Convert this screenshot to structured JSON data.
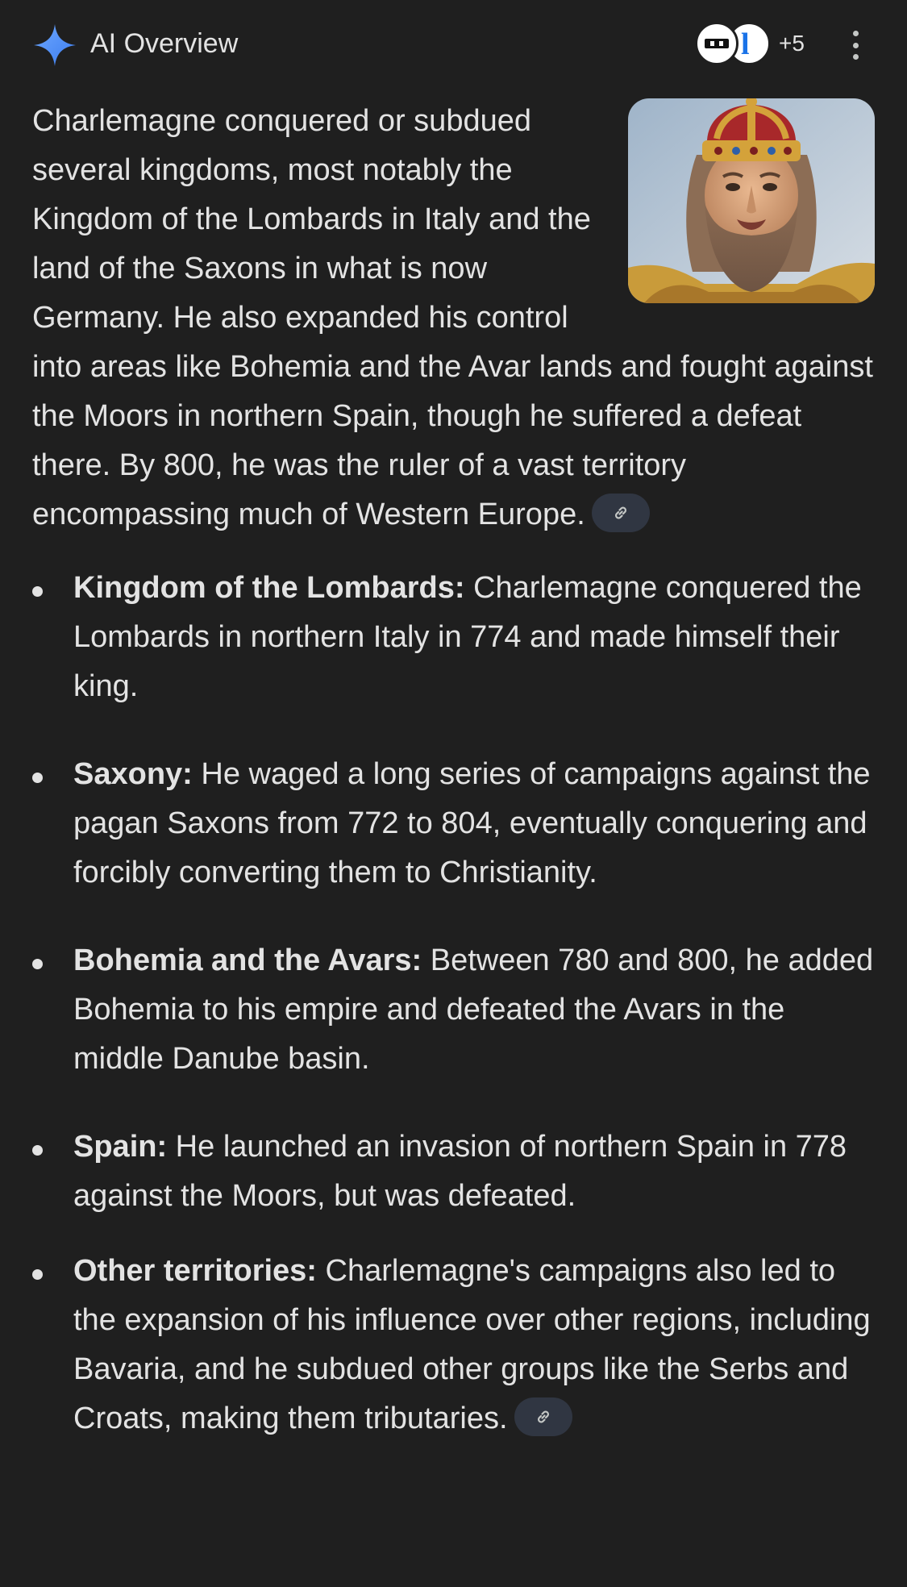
{
  "header": {
    "title": "AI Overview",
    "sparkle_icon": "gemini-sparkle-icon",
    "sources_more": "+5",
    "menu_icon": "more-vert-icon",
    "source_avatar_letter": "l"
  },
  "overview": {
    "intro": "Charlemagne conquered or subdued several kingdoms, most notably the Kingdom of the Lombards in Italy and the land of the Saxons in what is now Germany. He also expanded his control into areas like Bohemia and the Avar lands and fought against the Moors in northern Spain, though he suffered a defeat there. By 800, he was the ruler of a vast territory encompassing much of Western Europe.",
    "image_icon": "charlemagne-portrait",
    "link_icon": "link-icon"
  },
  "bullets": [
    {
      "title": "Kingdom of the Lombards:",
      "text": " Charlemagne conquered the Lombards in northern Italy in 774 and made himself their king."
    },
    {
      "title": "Saxony:",
      "text": " He waged a long series of campaigns against the pagan Saxons from 772 to 804, eventually conquering and forcibly converting them to Christianity."
    },
    {
      "title": "Bohemia and the Avars:",
      "text": " Between 780 and 800, he added Bohemia to his empire and defeated the Avars in the middle Danube basin."
    },
    {
      "title": "Spain:",
      "text": " He launched an invasion of northern Spain in 778 against the Moors, but was defeated."
    },
    {
      "title": "Other territories:",
      "text": " Charlemagne's campaigns also led to the expansion of his influence over other regions, including Bavaria, and he subdued other groups like the Serbs and Croats, making them tributaries."
    }
  ],
  "colors": {
    "background": "#1f1f1f",
    "text": "#e3e3e3",
    "sparkle": "#4c8df6",
    "chip": "#303642"
  }
}
